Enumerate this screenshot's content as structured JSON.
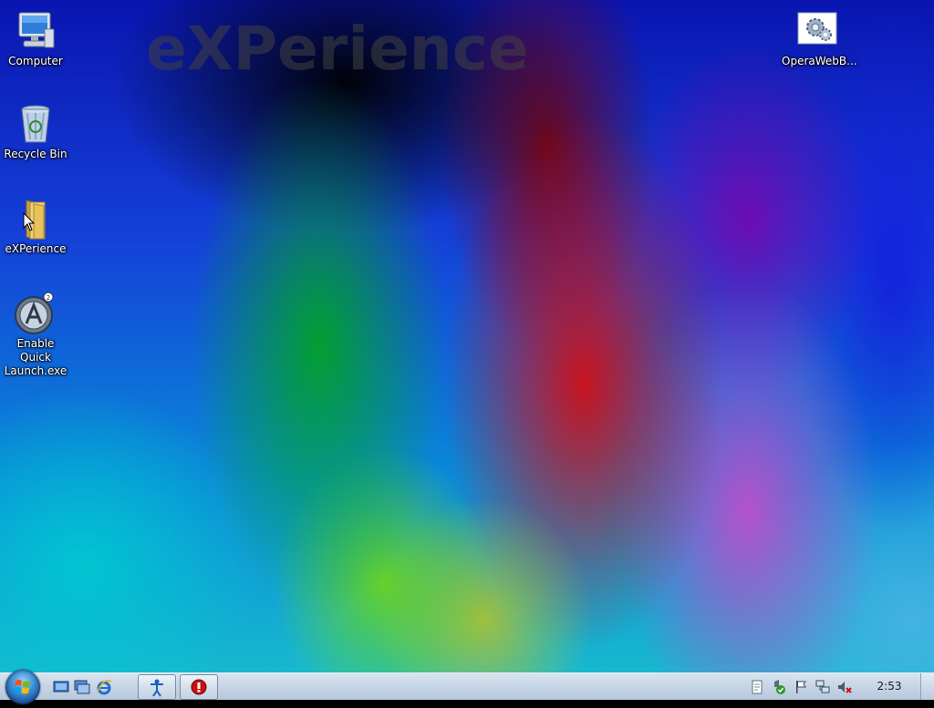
{
  "desktop": {
    "watermark_text": "eXPerience",
    "icons": [
      {
        "label": "Computer",
        "icon": "computer-icon"
      },
      {
        "label": "Recycle Bin",
        "icon": "recycle-bin-icon"
      },
      {
        "label": "eXPerience",
        "icon": "folder-icon"
      },
      {
        "label": "Enable Quick Launch.exe",
        "icon": "app-launcher-icon"
      },
      {
        "label": "OperaWebB...",
        "icon": "settings-file-icon"
      }
    ]
  },
  "taskbar": {
    "start_icon": "windows-start-icon",
    "quick_launch": [
      "show-desktop-icon",
      "switch-windows-icon",
      "internet-explorer-icon"
    ],
    "buttons": [
      "accessibility-app-icon",
      "stop-alert-icon"
    ],
    "tray": [
      "document-icon",
      "security-check-icon",
      "flag-icon",
      "network-icon",
      "volume-muted-icon"
    ],
    "clock": "2:53"
  },
  "colors": {
    "taskbar_top": "#d9e4ef",
    "taskbar_bottom": "#b7c8dc",
    "alert_red": "#c81010"
  }
}
